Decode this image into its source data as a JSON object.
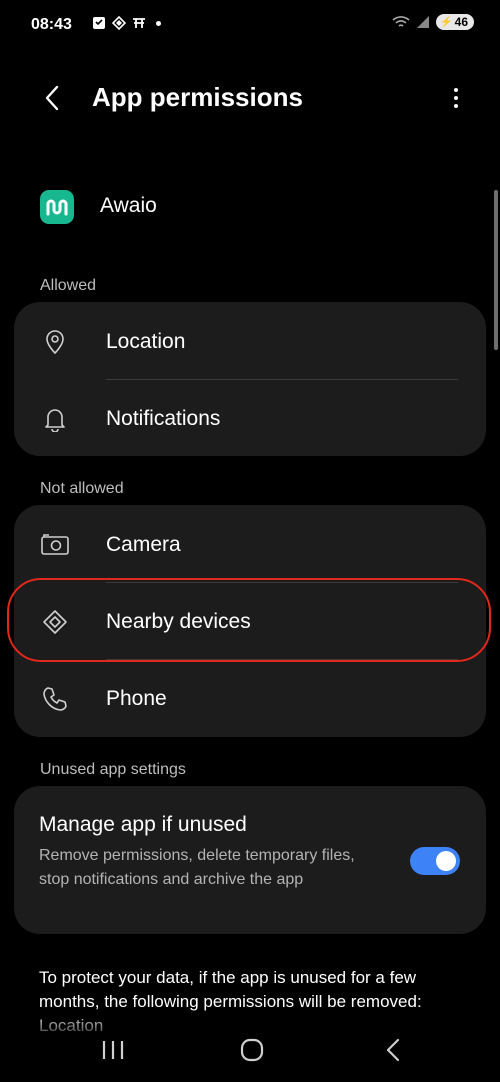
{
  "status_bar": {
    "time": "08:43",
    "battery": "46"
  },
  "header": {
    "title": "App permissions"
  },
  "app": {
    "name": "Awaio",
    "icon_color": "#17b890"
  },
  "allowed": {
    "label": "Allowed",
    "items": [
      {
        "label": "Location",
        "icon": "location-pin-icon"
      },
      {
        "label": "Notifications",
        "icon": "bell-icon"
      }
    ]
  },
  "not_allowed": {
    "label": "Not allowed",
    "items": [
      {
        "label": "Camera",
        "icon": "camera-icon"
      },
      {
        "label": "Nearby devices",
        "icon": "nearby-devices-icon"
      },
      {
        "label": "Phone",
        "icon": "phone-icon"
      }
    ]
  },
  "unused": {
    "label": "Unused app settings",
    "title": "Manage app if unused",
    "description": "Remove permissions, delete temporary files, stop notifications and archive the app",
    "enabled": true
  },
  "footer": {
    "text": "To protect your data, if the app is unused for a few months, the following permissions will be removed: Location"
  },
  "colors": {
    "accent": "#3e82f7",
    "highlight": "#e0281b",
    "card": "#1c1c1c"
  }
}
